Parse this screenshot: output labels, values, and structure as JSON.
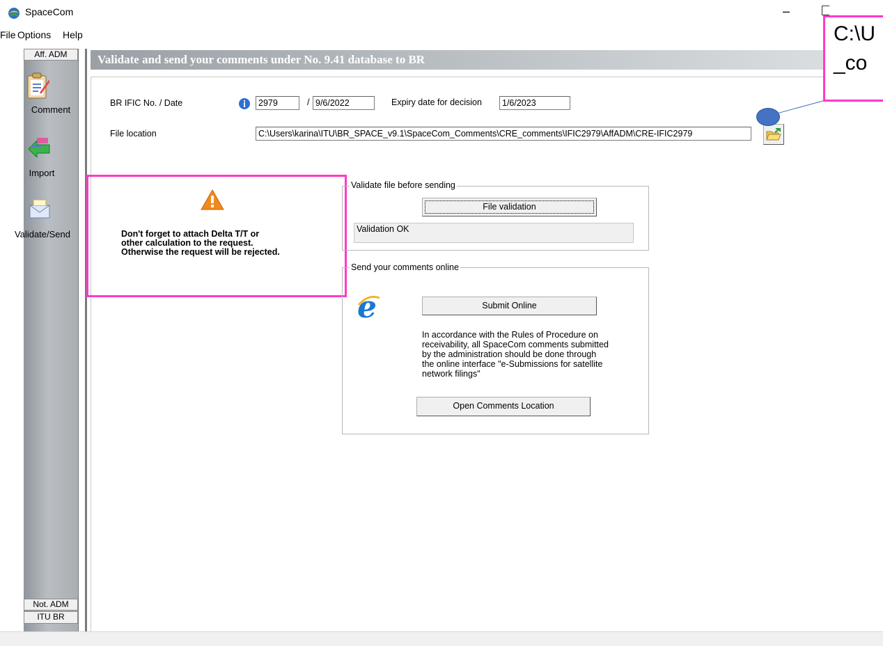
{
  "app": {
    "title": "SpaceCom",
    "minimize_glyph": "–"
  },
  "menu": [
    "File",
    "Options",
    "Help"
  ],
  "nav": {
    "top_header": "Aff. ADM",
    "items": [
      {
        "label": "Comment",
        "icon": "comment-clipboard-icon"
      },
      {
        "label": "Import",
        "icon": "import-arrow-icon"
      },
      {
        "label": "Validate/Send",
        "icon": "envelope-icon"
      }
    ],
    "bottom_headers": [
      "Not. ADM",
      "ITU BR"
    ]
  },
  "header": {
    "title": "Validate and send your comments under No. 9.41 database to BR"
  },
  "form": {
    "ific_label": "BR IFIC No. / Date",
    "ific_no": "2979",
    "date_sep": "/",
    "ific_date": "9/6/2022",
    "expiry_label": "Expiry date for decision",
    "expiry_date": "1/6/2023",
    "file_label": "File location",
    "file_path": "C:\\Users\\karina\\ITU\\BR_SPACE_v9.1\\SpaceCom_Comments\\CRE_comments\\IFIC2979\\AffADM\\CRE-IFIC2979"
  },
  "warning": {
    "lines": [
      "Don't forget to attach Delta T/T or",
      "other calculation to the request.",
      "Otherwise the request will be rejected."
    ]
  },
  "validate_group": {
    "title": "Validate file before sending",
    "button": "File validation",
    "result": "Validation OK"
  },
  "send_group": {
    "title": "Send your comments online",
    "submit_button": "Submit Online",
    "note": [
      "In accordance with the Rules of Procedure on",
      "receivability, all SpaceCom comments submitted",
      "by the administration should be done through",
      "the online interface \"e-Submissions for satellite",
      "network filings\""
    ],
    "open_button": "Open Comments Location"
  },
  "callout": {
    "line1": "C:\\U",
    "line2": "_co"
  },
  "colors": {
    "highlight": "#ff39c8",
    "callout_dot": "#4472c4"
  }
}
